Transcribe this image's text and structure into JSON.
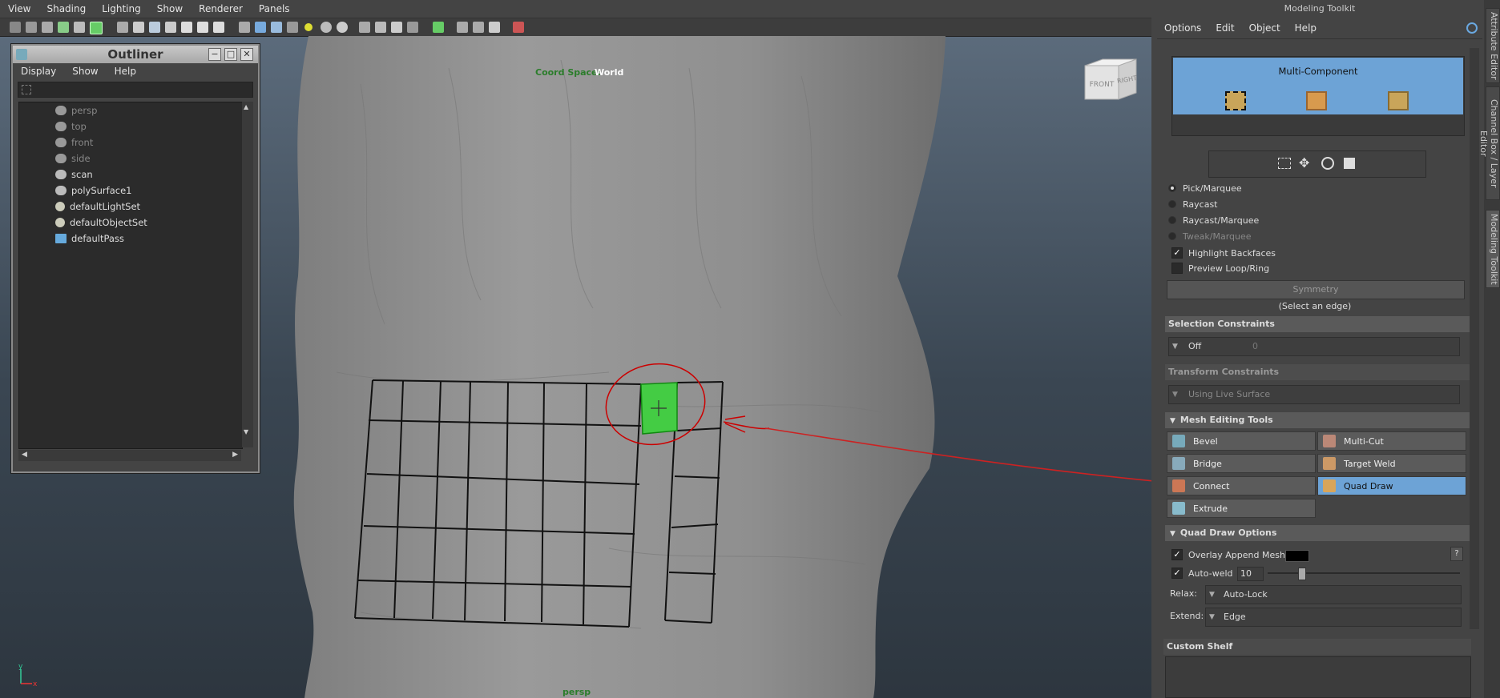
{
  "viewport": {
    "menus": [
      "View",
      "Shading",
      "Lighting",
      "Show",
      "Renderer",
      "Panels"
    ],
    "hud_coord_space_label": "Coord Space:",
    "hud_coord_space_value": "World",
    "camera_name": "persp",
    "viewcube_front": "FRONT",
    "viewcube_right": "RIGHT",
    "axis_y": "y",
    "axis_x": "x"
  },
  "outliner": {
    "title": "Outliner",
    "menus": [
      "Display",
      "Show",
      "Help"
    ],
    "items": [
      {
        "label": "persp",
        "dim": true,
        "icon": "camera-icon"
      },
      {
        "label": "top",
        "dim": true,
        "icon": "camera-icon"
      },
      {
        "label": "front",
        "dim": true,
        "icon": "camera-icon"
      },
      {
        "label": "side",
        "dim": true,
        "icon": "camera-icon"
      },
      {
        "label": "scan",
        "dim": false,
        "icon": "mesh-icon"
      },
      {
        "label": "polySurface1",
        "dim": false,
        "icon": "mesh-icon"
      },
      {
        "label": "defaultLightSet",
        "dim": false,
        "icon": "set-icon"
      },
      {
        "label": "defaultObjectSet",
        "dim": false,
        "icon": "set-icon"
      },
      {
        "label": "defaultPass",
        "dim": false,
        "icon": "render-pass-icon"
      }
    ]
  },
  "toolkit": {
    "title": "Modeling Toolkit",
    "menus": [
      "Options",
      "Edit",
      "Object",
      "Help"
    ],
    "multi_component": "Multi-Component",
    "modes": [
      {
        "label": "Pick/Marquee",
        "on": true
      },
      {
        "label": "Raycast",
        "on": false
      },
      {
        "label": "Raycast/Marquee",
        "on": false
      },
      {
        "label": "Tweak/Marquee",
        "on": false
      }
    ],
    "highlight_backfaces": "Highlight Backfaces",
    "preview_loop_ring": "Preview Loop/Ring",
    "symmetry_label": "Symmetry",
    "symmetry_hint": "(Select an edge)",
    "selection_constraints": "Selection Constraints",
    "selection_constraint_value": "Off",
    "selection_constraint_num": "0",
    "transform_constraints": "Transform Constraints",
    "transform_constraint_value": "Using Live Surface",
    "mesh_editing_tools": "Mesh Editing Tools",
    "tools": [
      "Bevel",
      "Multi-Cut",
      "Bridge",
      "Target Weld",
      "Connect",
      "Quad Draw",
      "Extrude"
    ],
    "quad_draw_options": "Quad Draw Options",
    "overlay_append_mesh": "Overlay Append Mesh",
    "auto_weld": "Auto-weld",
    "auto_weld_value": "10",
    "auto_weld_fraction": 0.16,
    "relax_label": "Relax:",
    "relax_value": "Auto-Lock",
    "extend_label": "Extend:",
    "extend_value": "Edge",
    "custom_shelf": "Custom Shelf",
    "help_glyph": "?"
  },
  "side_tabs": [
    "Attribute Editor",
    "Channel Box / Layer Editor",
    "Modeling Toolkit"
  ]
}
